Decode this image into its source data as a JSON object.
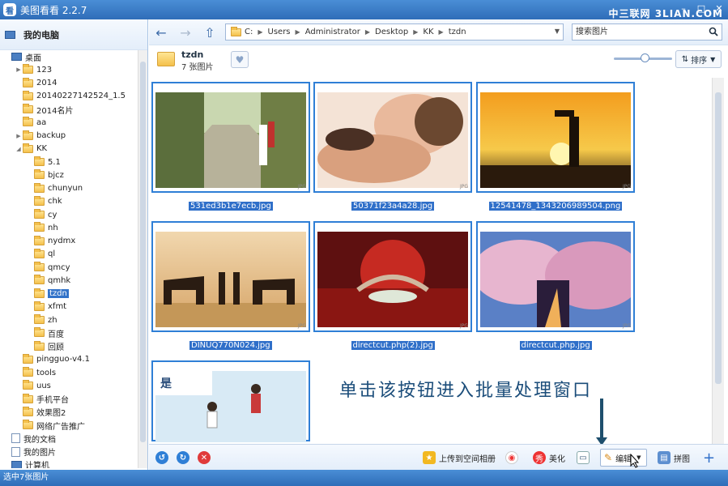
{
  "window": {
    "title": "美图看看 2.2.7",
    "watermark": "中三联网 3LIAN.COM",
    "app_badge": "看"
  },
  "sidebar": {
    "root_label": "我的电脑",
    "tree": [
      {
        "label": "桌面",
        "level": 0,
        "icon": "pc",
        "arrow": ""
      },
      {
        "label": "123",
        "level": 1,
        "icon": "folder",
        "arrow": "▶"
      },
      {
        "label": "2014",
        "level": 1,
        "icon": "folder",
        "arrow": ""
      },
      {
        "label": "20140227142524_1.5",
        "level": 1,
        "icon": "folder",
        "arrow": ""
      },
      {
        "label": "2014名片",
        "level": 1,
        "icon": "folder",
        "arrow": ""
      },
      {
        "label": "aa",
        "level": 1,
        "icon": "folder",
        "arrow": ""
      },
      {
        "label": "backup",
        "level": 1,
        "icon": "folder",
        "arrow": "▶"
      },
      {
        "label": "KK",
        "level": 1,
        "icon": "folder",
        "arrow": "◢"
      },
      {
        "label": "5.1",
        "level": 2,
        "icon": "folder",
        "arrow": ""
      },
      {
        "label": "bjcz",
        "level": 2,
        "icon": "folder",
        "arrow": ""
      },
      {
        "label": "chunyun",
        "level": 2,
        "icon": "folder",
        "arrow": ""
      },
      {
        "label": "chk",
        "level": 2,
        "icon": "folder",
        "arrow": ""
      },
      {
        "label": "cy",
        "level": 2,
        "icon": "folder",
        "arrow": ""
      },
      {
        "label": "nh",
        "level": 2,
        "icon": "folder",
        "arrow": ""
      },
      {
        "label": "nydmx",
        "level": 2,
        "icon": "folder",
        "arrow": ""
      },
      {
        "label": "ql",
        "level": 2,
        "icon": "folder",
        "arrow": ""
      },
      {
        "label": "qmcy",
        "level": 2,
        "icon": "folder",
        "arrow": ""
      },
      {
        "label": "qmhk",
        "level": 2,
        "icon": "folder",
        "arrow": ""
      },
      {
        "label": "tzdn",
        "level": 2,
        "icon": "folder",
        "arrow": "",
        "selected": true
      },
      {
        "label": "xfmt",
        "level": 2,
        "icon": "folder",
        "arrow": ""
      },
      {
        "label": "zh",
        "level": 2,
        "icon": "folder",
        "arrow": ""
      },
      {
        "label": "百度",
        "level": 2,
        "icon": "folder",
        "arrow": ""
      },
      {
        "label": "回顾",
        "level": 2,
        "icon": "folder",
        "arrow": ""
      },
      {
        "label": "pingguo-v4.1",
        "level": 1,
        "icon": "folder",
        "arrow": ""
      },
      {
        "label": "tools",
        "level": 1,
        "icon": "folder",
        "arrow": ""
      },
      {
        "label": "uus",
        "level": 1,
        "icon": "folder",
        "arrow": ""
      },
      {
        "label": "手机平台",
        "level": 1,
        "icon": "folder",
        "arrow": ""
      },
      {
        "label": "效果图2",
        "level": 1,
        "icon": "folder",
        "arrow": ""
      },
      {
        "label": "网络广告推广",
        "level": 1,
        "icon": "folder",
        "arrow": ""
      },
      {
        "label": "我的文档",
        "level": 0,
        "icon": "doc",
        "arrow": ""
      },
      {
        "label": "我的图片",
        "level": 0,
        "icon": "doc",
        "arrow": ""
      },
      {
        "label": "计算机",
        "level": 0,
        "icon": "pc",
        "arrow": ""
      }
    ]
  },
  "address": {
    "crumbs": [
      "C:",
      "Users",
      "Administrator",
      "Desktop",
      "KK",
      "tzdn"
    ],
    "search_placeholder": "搜索图片"
  },
  "folder_info": {
    "name": "tzdn",
    "count": "7 张图片",
    "sort_label": "排序"
  },
  "images": [
    {
      "filename": "531ed3b1e7ecb.jpg",
      "tag": "JPG"
    },
    {
      "filename": "50371f23a4a28.jpg",
      "tag": "JPG"
    },
    {
      "filename": "12541478_1343206989504.png",
      "tag": "JPG"
    },
    {
      "filename": "DINUQ770N024.jpg",
      "tag": "JPG"
    },
    {
      "filename": "directcut.php(2).jpg",
      "tag": "JPG"
    },
    {
      "filename": "directcut.php.jpg",
      "tag": "JPG"
    },
    {
      "filename": "",
      "tag": ""
    }
  ],
  "annotation": "单击该按钮进入批量处理窗口",
  "toolbar": {
    "upload_label": "上传到空间相册",
    "beautify_label": "美化",
    "edit_label": "编辑",
    "puzzle_label": "拼图",
    "tooltip": "编辑"
  },
  "status": {
    "text": "选中7张图片"
  },
  "colors": {
    "accent": "#2f6db8",
    "selection": "#2f7fd6"
  }
}
